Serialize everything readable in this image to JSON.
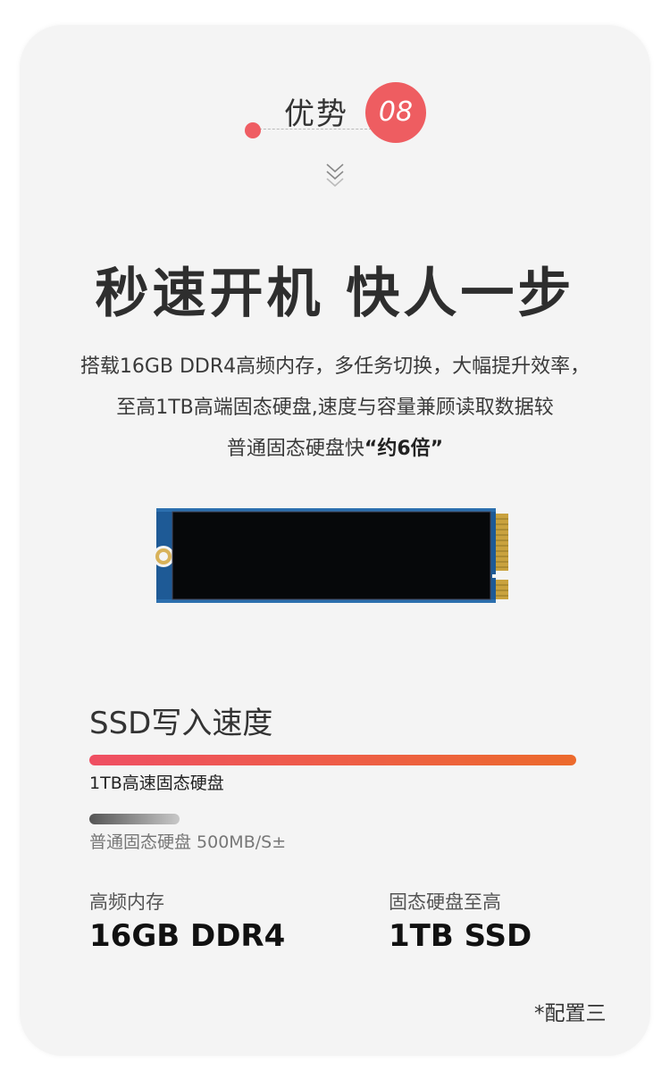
{
  "header": {
    "title": "优势",
    "number": "08"
  },
  "headline": "秒速开机 快人一步",
  "description": {
    "line1": "搭载16GB DDR4高频内存，多任务切换，大幅提升效率，",
    "line2": "至高1TB高端固态硬盘,速度与容量兼顾读取数据较",
    "line3_prefix": "普通固态硬盘快",
    "line3_highlight": "“约6倍”"
  },
  "speed": {
    "title": "SSD写入速度",
    "fast_label": "1TB高速固态硬盘",
    "normal_label": "普通固态硬盘 500MB/S±",
    "fast_relative": 1.0,
    "normal_relative": 0.185
  },
  "specs": [
    {
      "label": "高频内存",
      "value": "16GB DDR4"
    },
    {
      "label": "固态硬盘至高",
      "value": "1TB SSD"
    }
  ],
  "note": "*配置三",
  "colors": {
    "accent": "#ee5d61",
    "bar_start": "#ef4f63",
    "bar_end": "#ec6a2c",
    "pcb": "#1e5a96"
  }
}
